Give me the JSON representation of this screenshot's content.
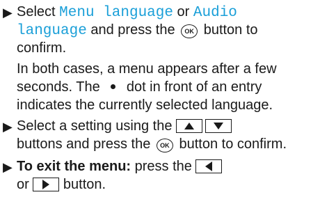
{
  "instructions": [
    {
      "lines": [
        {
          "parts": [
            {
              "t": "text",
              "v": "Select "
            },
            {
              "t": "mono",
              "v": "Menu language"
            },
            {
              "t": "text",
              "v": " or "
            },
            {
              "t": "mono",
              "v": "Audio"
            }
          ]
        },
        {
          "parts": [
            {
              "t": "mono",
              "v": "language"
            },
            {
              "t": "text",
              "v": " and press the "
            },
            {
              "t": "icon",
              "v": "OK"
            },
            {
              "t": "text",
              "v": " button to"
            }
          ]
        },
        {
          "parts": [
            {
              "t": "text",
              "v": "confirm."
            }
          ]
        },
        {
          "parts": [
            {
              "t": "text",
              "v": "In both cases, a menu appears after a few"
            }
          ]
        },
        {
          "parts": [
            {
              "t": "text",
              "v": "seconds. The "
            },
            {
              "t": "dot"
            },
            {
              "t": "text",
              "v": " dot in front of an entry"
            }
          ]
        },
        {
          "parts": [
            {
              "t": "text",
              "v": "indicates the currently selected language."
            }
          ]
        }
      ]
    },
    {
      "lines": [
        {
          "parts": [
            {
              "t": "text",
              "v": "Select a setting using the "
            },
            {
              "t": "key",
              "v": "up"
            },
            {
              "t": "key",
              "v": "down"
            }
          ]
        },
        {
          "parts": [
            {
              "t": "text",
              "v": "buttons and press the "
            },
            {
              "t": "icon",
              "v": "OK"
            },
            {
              "t": "text",
              "v": " button to confirm."
            }
          ]
        }
      ]
    },
    {
      "lines": [
        {
          "parts": [
            {
              "t": "bold",
              "v": "To exit the menu:"
            },
            {
              "t": "text",
              "v": " press the "
            },
            {
              "t": "key",
              "v": "left"
            }
          ]
        },
        {
          "parts": [
            {
              "t": "text",
              "v": "or "
            },
            {
              "t": "key",
              "v": "right"
            },
            {
              "t": "text",
              "v": " button."
            }
          ]
        }
      ]
    }
  ],
  "icons": {
    "bullet": "▶",
    "ok_button": "ok-button-icon",
    "selection_dot": "selection-dot-icon",
    "arrow_keys": [
      "up-arrow-key-icon",
      "down-arrow-key-icon",
      "left-arrow-key-icon",
      "right-arrow-key-icon"
    ]
  },
  "colors": {
    "text": "#1a1a1a",
    "menu_term": "#1a9fd8"
  }
}
